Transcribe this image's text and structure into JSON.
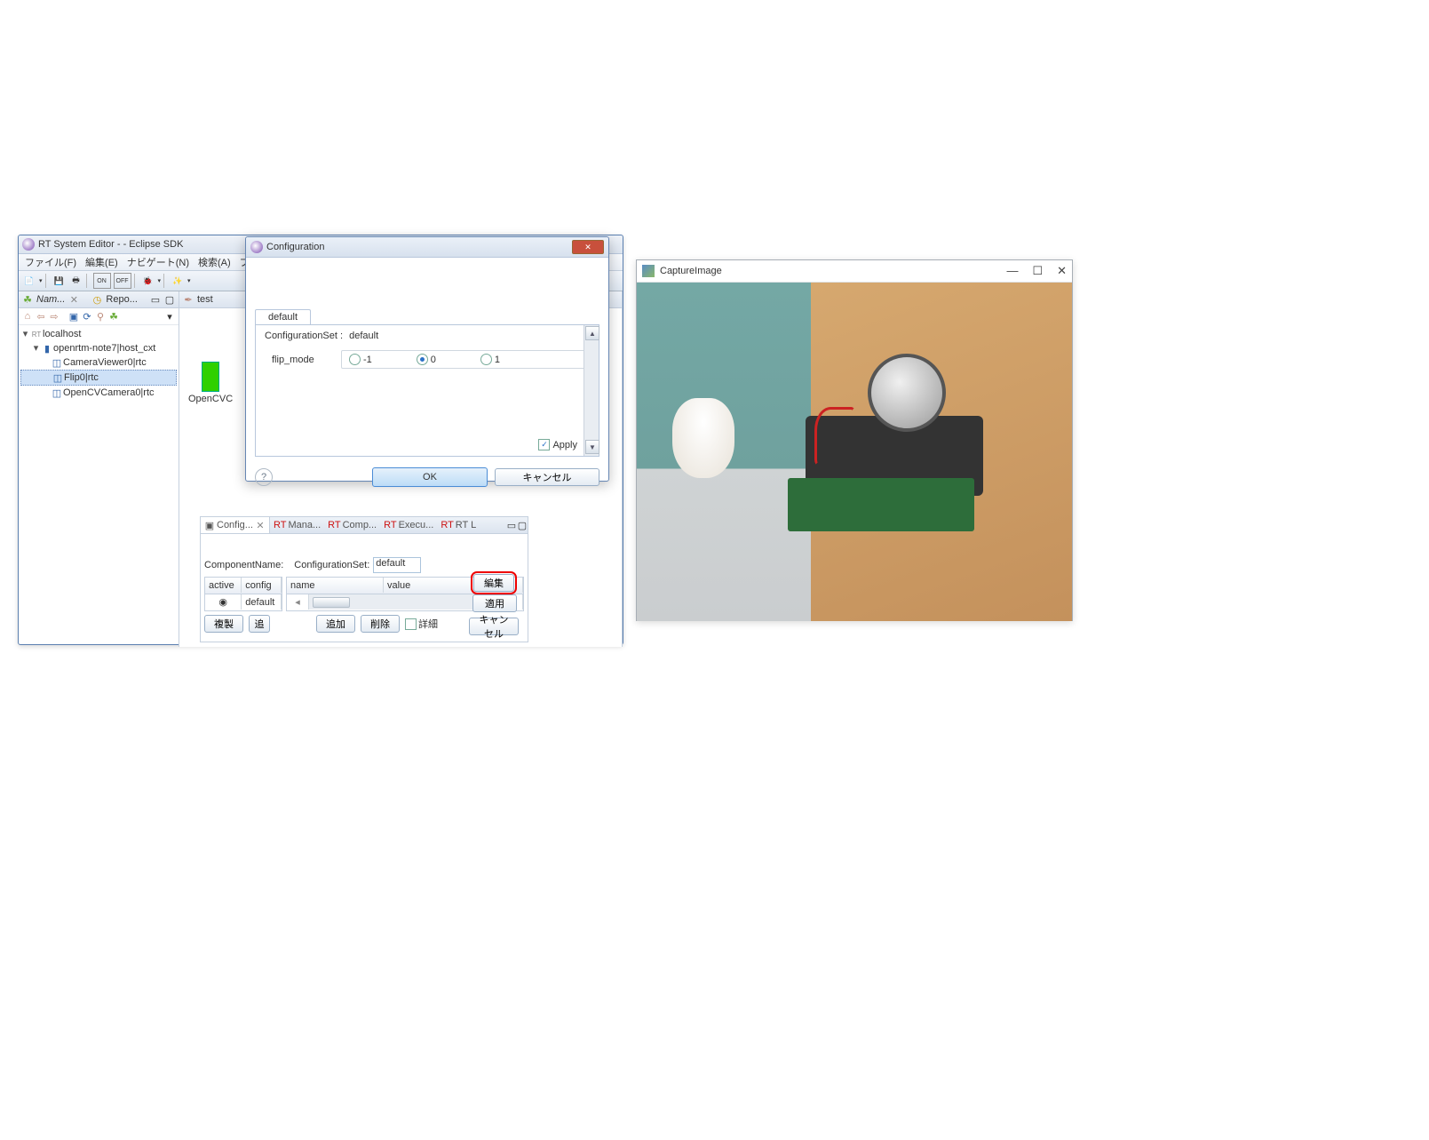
{
  "eclipse": {
    "title": "RT System Editor -  - Eclipse SDK",
    "menu": [
      "ファイル(F)",
      "編集(E)",
      "ナビゲート(N)",
      "検索(A)",
      "プロジ"
    ],
    "nameservice_view": {
      "tab_active": "Nam...",
      "tab_icon_active": "✕",
      "tab_inactive": "Repo...",
      "tree": {
        "root": "localhost",
        "host": "openrtm-note7|host_cxt",
        "items": [
          "CameraViewer0|rtc",
          "Flip0|rtc",
          "OpenCVCamera0|rtc"
        ]
      }
    },
    "editor": {
      "tab": "test",
      "component_label": "OpenCVC"
    }
  },
  "config_view": {
    "tabs": [
      "Config...",
      "Mana...",
      "Comp...",
      "Execu...",
      "RT L"
    ],
    "component_name_label": "ComponentName:",
    "configset_label": "ConfigurationSet:",
    "configset_value": "default",
    "columns_left": [
      "active",
      "config"
    ],
    "columns_right": [
      "name",
      "value"
    ],
    "row_config": "default",
    "buttons": {
      "copy": "複製",
      "add_left": "追",
      "add": "追加",
      "delete": "削除",
      "detail": "詳細",
      "edit": "編集",
      "apply": "適用",
      "cancel": "キャンセル"
    }
  },
  "dialog": {
    "title": "Configuration",
    "tab": "default",
    "configset_label": "ConfigurationSet :",
    "configset_value": "default",
    "param_name": "flip_mode",
    "options": [
      "-1",
      "0",
      "1"
    ],
    "selected_option": "0",
    "apply_label": "Apply",
    "ok": "OK",
    "cancel": "キャンセル"
  },
  "capture": {
    "title": "CaptureImage",
    "controls": {
      "min": "—",
      "max": "☐",
      "close": "✕"
    }
  },
  "icons": {
    "x": "✕",
    "rt": "RT",
    "help": "?",
    "check": "✓",
    "pin": "✒",
    "leaf": "☘",
    "expand": "▾",
    "collapse": "▸",
    "up": "▲",
    "down": "▼",
    "min_box": "▭"
  }
}
